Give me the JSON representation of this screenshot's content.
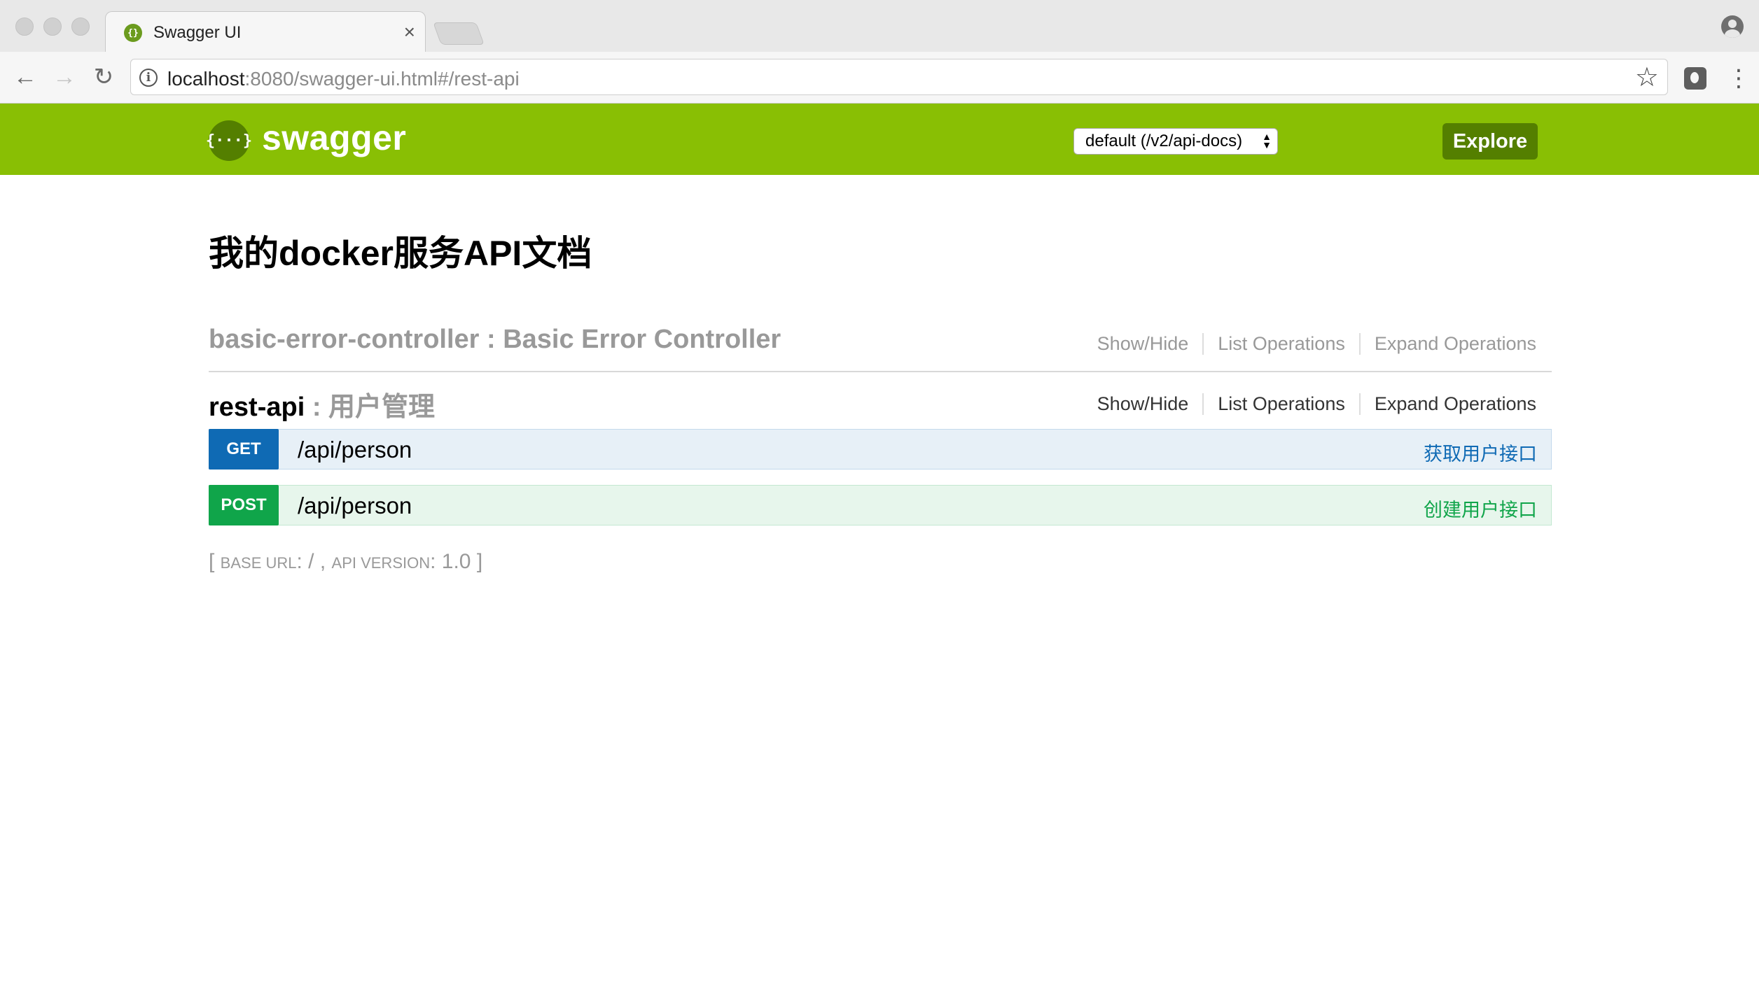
{
  "browser": {
    "tab_title": "Swagger UI",
    "tab_close": "×",
    "url_host": "localhost",
    "url_rest": ":8080/swagger-ui.html#/rest-api",
    "nav_back": "←",
    "nav_forward": "→",
    "nav_reload": "↻",
    "star": "☆",
    "menu": "⋮"
  },
  "header": {
    "logo_glyph": "{···}",
    "brand": "swagger",
    "spec_select_value": "default (/v2/api-docs)",
    "explore_label": "Explore",
    "color": "#89bf04"
  },
  "page_title": "我的docker服务API文档",
  "resources": [
    {
      "name": "basic-error-controller",
      "description": " : Basic Error Controller",
      "links": [
        "Show/Hide",
        "List Operations",
        "Expand Operations"
      ]
    },
    {
      "name": "rest-api",
      "description": " : 用户管理",
      "links": [
        "Show/Hide",
        "List Operations",
        "Expand Operations"
      ],
      "operations": [
        {
          "method": "GET",
          "path": "/api/person",
          "summary": "获取用户接口",
          "color": "#0f6ab4"
        },
        {
          "method": "POST",
          "path": "/api/person",
          "summary": "创建用户接口",
          "color": "#10a54a"
        }
      ]
    }
  ],
  "footer": {
    "open": "[ ",
    "base_url_label": "base url",
    "base_url_value": ": / , ",
    "api_version_label": "api version",
    "api_version_value": ": 1.0 ",
    "close": "]"
  }
}
